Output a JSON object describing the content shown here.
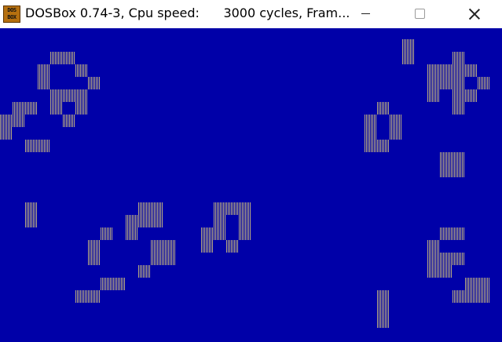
{
  "window": {
    "app_icon_text": [
      "DOS",
      "BOX"
    ],
    "title": "DOSBox 0.74-3, Cpu speed:      3000 cycles, Fram..."
  },
  "colors": {
    "screen_bg": "#0000a8",
    "cell_color": "#d8c87a",
    "titlebar_bg": "#ffffff"
  },
  "controls": {
    "minimize_icon": "minimize-icon",
    "maximize_icon": "maximize-icon",
    "close_icon": "close-icon"
  }
}
